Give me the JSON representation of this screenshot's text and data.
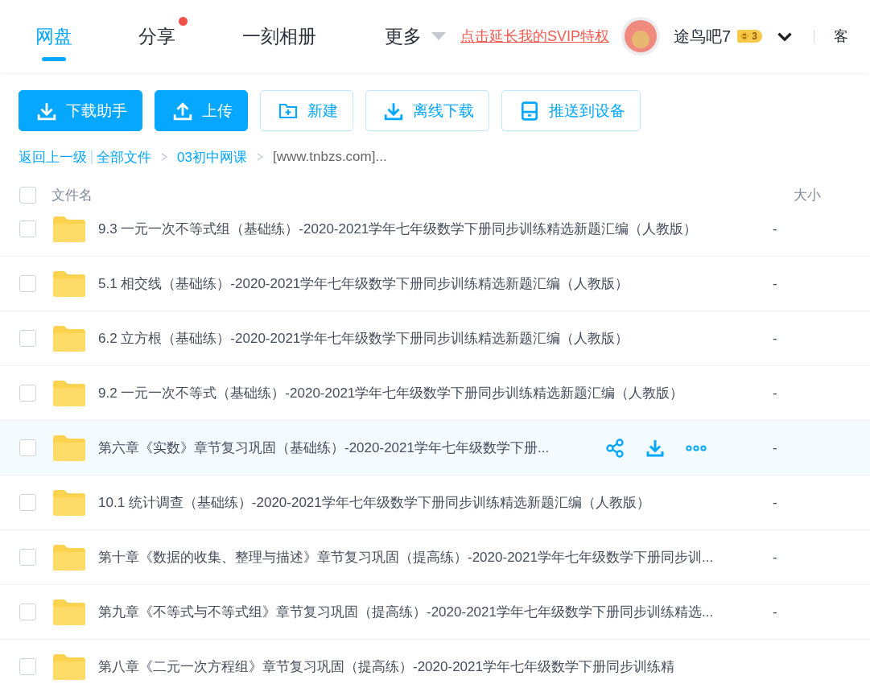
{
  "nav": {
    "tabs": [
      {
        "label": "网盘",
        "selected": true,
        "dot": false
      },
      {
        "label": "分享",
        "selected": false,
        "dot": true
      },
      {
        "label": "一刻相册",
        "selected": false,
        "dot": false
      },
      {
        "label": "更多",
        "selected": false,
        "dot": false,
        "dropdown": true
      }
    ],
    "promo_link": "点击延长我的SVIP特权",
    "username": "途鸟吧7",
    "vip_badge": "3",
    "cut_item": "客"
  },
  "toolbar": [
    {
      "label": "下载助手",
      "kind": "download",
      "primary": true
    },
    {
      "label": "上传",
      "kind": "upload",
      "primary": true
    },
    {
      "label": "新建",
      "kind": "folder",
      "primary": false
    },
    {
      "label": "离线下载",
      "kind": "download",
      "primary": false
    },
    {
      "label": "推送到设备",
      "kind": "device",
      "primary": false
    }
  ],
  "breadcrumb": {
    "back": "返回上一级",
    "path": [
      "全部文件",
      "03初中网课"
    ],
    "current": "[www.tnbzs.com]..."
  },
  "table": {
    "columns": [
      "文件名",
      "大小"
    ],
    "all_checked": false,
    "rows": [
      {
        "name": "9.3 一元一次不等式组（基础练）-2020-2021学年七年级数学下册同步训练精选新题汇编（人教版）",
        "size": "-",
        "hovered": false
      },
      {
        "name": "5.1 相交线（基础练）-2020-2021学年七年级数学下册同步训练精选新题汇编（人教版）",
        "size": "-",
        "hovered": false
      },
      {
        "name": "6.2 立方根（基础练）-2020-2021学年七年级数学下册同步训练精选新题汇编（人教版）",
        "size": "-",
        "hovered": false
      },
      {
        "name": "9.2 一元一次不等式（基础练）-2020-2021学年七年级数学下册同步训练精选新题汇编（人教版）",
        "size": "-",
        "hovered": false
      },
      {
        "name": "第六章《实数》章节复习巩固（基础练）-2020-2021学年七年级数学下册...",
        "size": "-",
        "hovered": true
      },
      {
        "name": "10.1 统计调查（基础练）-2020-2021学年七年级数学下册同步训练精选新题汇编（人教版）",
        "size": "-",
        "hovered": false
      },
      {
        "name": "第十章《数据的收集、整理与描述》章节复习巩固（提高练）-2020-2021学年七年级数学下册同步训...",
        "size": "-",
        "hovered": false
      },
      {
        "name": "第九章《不等式与不等式组》章节复习巩固（提高练）-2020-2021学年七年级数学下册同步训练精选...",
        "size": "-",
        "hovered": false
      },
      {
        "name": "第八章《二元一次方程组》章节复习巩固（提高练）-2020-2021学年七年级数学下册同步训练精",
        "hovered": false
      }
    ]
  }
}
